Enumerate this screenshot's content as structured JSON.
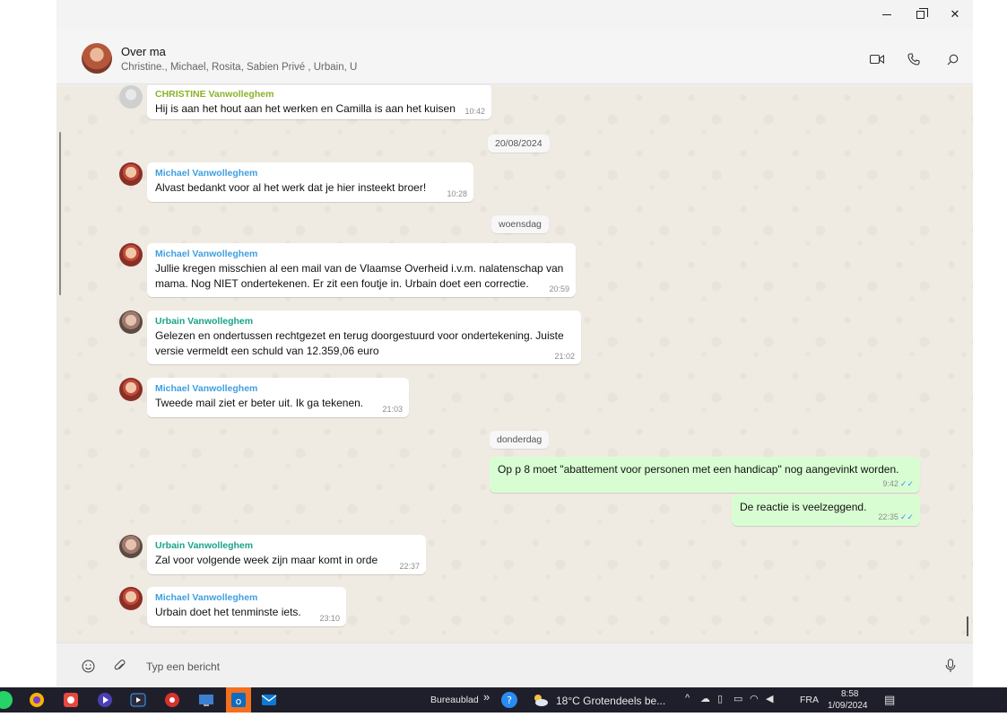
{
  "window": {
    "minimize": "–",
    "maximize": "",
    "close": "✕"
  },
  "chat": {
    "title": "Over ma",
    "members": "Christine., Michael, Rosita, Sabien    Privé , Urbain, U"
  },
  "icons": {
    "video": "video-icon",
    "call": "phone-icon",
    "search": "search-icon",
    "emoji": "emoji-icon",
    "attach": "paperclip-icon",
    "mic": "microphone-icon"
  },
  "messages": {
    "m1": {
      "sender": "CHRISTINE Vanwolleghem",
      "text": "Hij is aan het hout aan het werken en Camilla is aan het kuisen",
      "time": "10:42"
    },
    "d1": "20/08/2024",
    "m2": {
      "sender": "Michael Vanwolleghem",
      "text": "Alvast bedankt voor al het werk dat je hier insteekt broer!",
      "time": "10:28"
    },
    "d2": "woensdag",
    "m3": {
      "sender": "Michael Vanwolleghem",
      "line1": "Jullie kregen misschien al een mail van de Vlaamse Overheid i.v.m. nalatenschap van",
      "line2": "mama.  Nog NIET ondertekenen.  Er zit een foutje in. Urbain doet een correctie.",
      "time": "20:59"
    },
    "m4": {
      "sender": "Urbain Vanwolleghem",
      "line1": "Gelezen en ondertussen rechtgezet en terug doorgestuurd voor ondertekening. Juiste",
      "line2": "versie vermeldt een schuld van 12.359,06 euro",
      "time": "21:02"
    },
    "m5": {
      "sender": "Michael Vanwolleghem",
      "text": "Tweede mail ziet er beter uit.  Ik ga tekenen.",
      "time": "21:03"
    },
    "d3": "donderdag",
    "o1": {
      "text": "Op p 8 moet \"abattement voor personen met een handicap\" nog aangevinkt worden.",
      "time": "9:42"
    },
    "o2": {
      "text": "De reactie is veelzeggend.",
      "time": "22:35"
    },
    "m6": {
      "sender": "Urbain Vanwolleghem",
      "text": "Zal voor volgende week zijn  maar komt in orde",
      "time": "22:37"
    },
    "m7": {
      "sender": "Michael Vanwolleghem",
      "text": "Urbain doet het tenminste iets.",
      "time": "23:10"
    },
    "tick": "✓✓"
  },
  "composer": {
    "placeholder": "Typ een bericht"
  },
  "taskbar": {
    "desktop_label": "Bureaublad",
    "chevrons": "»",
    "weather": "18°C  Grotendeels be...",
    "language": "FRA",
    "time": "8:58",
    "date": "1/09/2024",
    "colors": {
      "whatsapp": "#25d366",
      "edge": "#f5b400",
      "gmail": "#e8473d",
      "media": "#5a4fcf",
      "pdf": "#d8322c",
      "outlook": "#1a73c8",
      "mail": "#0e78d5"
    }
  }
}
